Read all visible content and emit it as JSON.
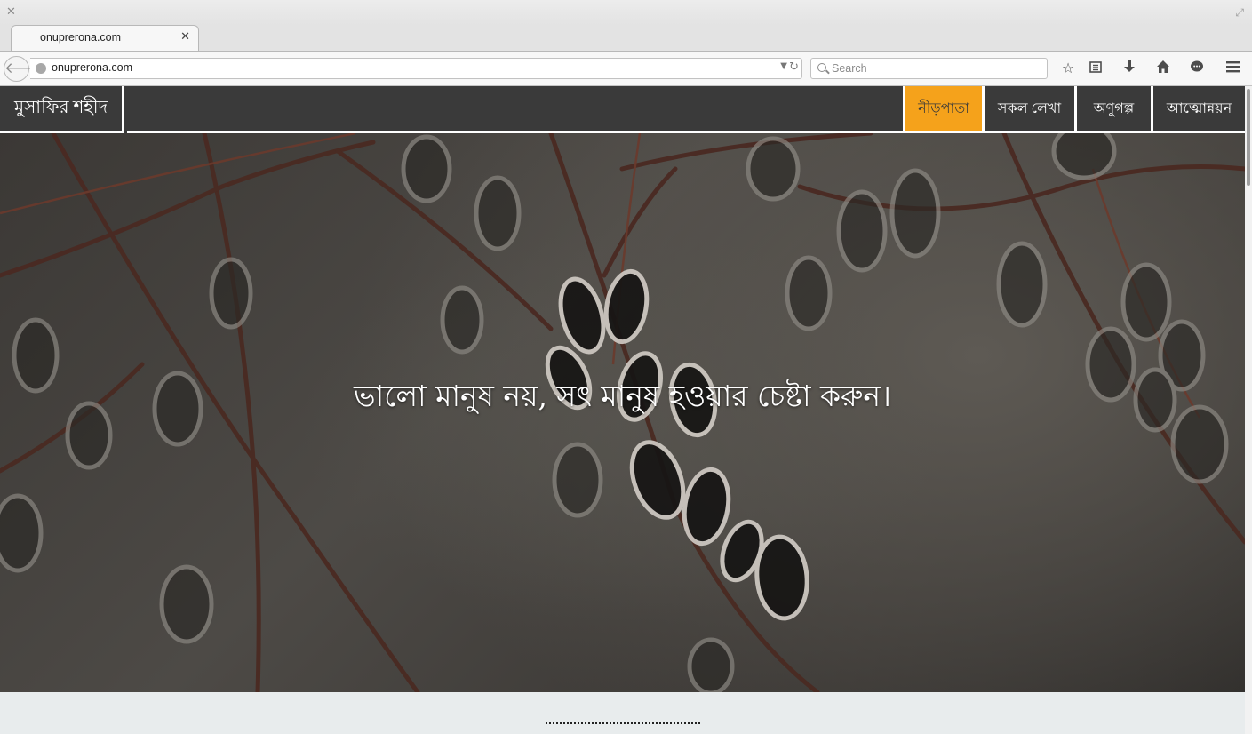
{
  "browser": {
    "tab_title": "onuprerona.com",
    "url": "onuprerona.com",
    "search_placeholder": "Search",
    "toolbar_icons": [
      "bookmark-star-icon",
      "reading-list-icon",
      "download-icon",
      "home-icon",
      "chat-icon",
      "menu-icon"
    ]
  },
  "site": {
    "brand": "মুসাফির শহীদ",
    "menu": [
      {
        "label": "নীড়পাতা",
        "active": true
      },
      {
        "label": "সকল লেখা",
        "active": false
      },
      {
        "label": "অণুগল্প",
        "active": false
      },
      {
        "label": "আত্মোন্নয়ন",
        "active": false
      }
    ],
    "hero_quote": "ভালো মানুষ নয়, সৎ মানুষ হওয়ার চেষ্টা করুন।"
  },
  "colors": {
    "header_bg": "#3a3a3a",
    "active_menu_bg": "#f5a21b",
    "page_bg": "#e8eced"
  }
}
